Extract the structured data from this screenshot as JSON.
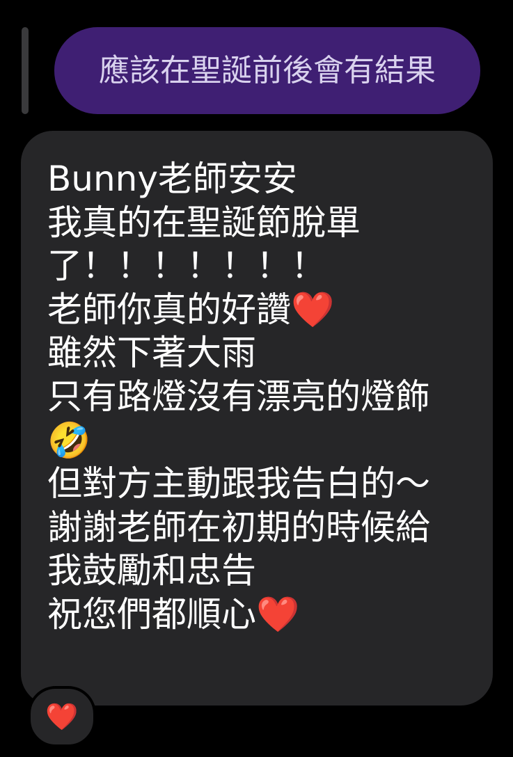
{
  "quoted_message": {
    "text": "應該在聖誕前後會有結果"
  },
  "message": {
    "lines": [
      "Bunny老師安安",
      "我真的在聖誕節脫單",
      "了！！！！！！！",
      "老師你真的好讚❤️",
      "雖然下著大雨",
      "只有路燈沒有漂亮的燈飾",
      "🤣",
      "但對方主動跟我告白的～",
      "謝謝老師在初期的時候給",
      "我鼓勵和忠告",
      "祝您們都順心❤️"
    ]
  },
  "reaction": {
    "icon": "heart-icon",
    "emoji": "❤️"
  },
  "colors": {
    "background": "#000000",
    "quoted_bubble": "#3f1f73",
    "quoted_text": "#d9d2ee",
    "message_bubble": "#262628",
    "message_text": "#ffffff",
    "heart": "#e0202e"
  }
}
